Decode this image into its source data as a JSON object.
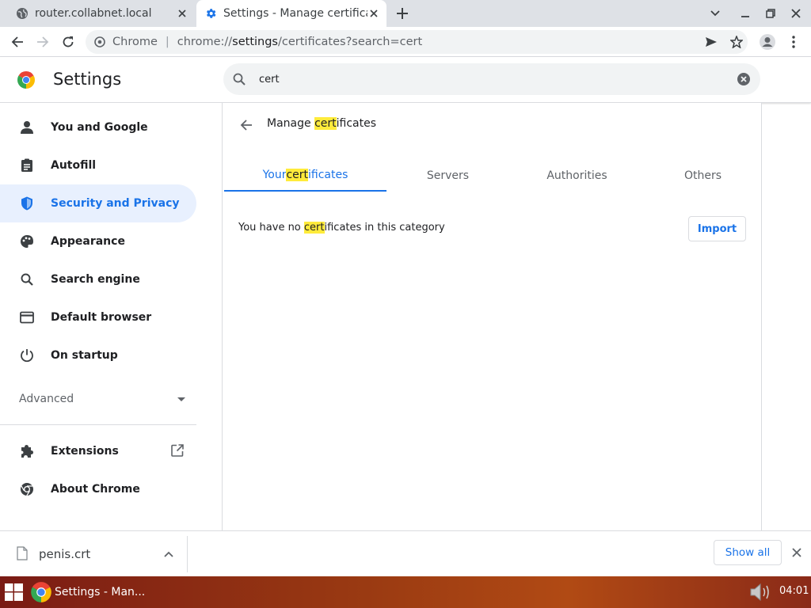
{
  "colors": {
    "accent": "#1a73e8",
    "highlight": "#ffeb3b",
    "active_nav_bg": "#e8f0fe",
    "tabstrip_bg": "#dee1e6"
  },
  "browser": {
    "tabs": [
      {
        "title": "router.collabnet.local",
        "icon": "globe-icon",
        "active": false
      },
      {
        "title": "Settings - Manage certifica",
        "icon": "gear-icon",
        "active": true
      }
    ],
    "omnibox": {
      "chip": "Chrome",
      "url_scheme": "chrome://",
      "url_host": "settings",
      "url_rest": "/certificates?search=cert"
    }
  },
  "settings": {
    "title": "Settings",
    "search_value": "cert",
    "nav": [
      {
        "label": "You and Google",
        "icon": "person-icon"
      },
      {
        "label": "Autofill",
        "icon": "clipboard-icon"
      },
      {
        "label": "Security and Privacy",
        "icon": "shield-icon",
        "active": true
      },
      {
        "label": "Appearance",
        "icon": "palette-icon"
      },
      {
        "label": "Search engine",
        "icon": "search-icon"
      },
      {
        "label": "Default browser",
        "icon": "browser-window-icon"
      },
      {
        "label": "On startup",
        "icon": "power-icon"
      }
    ],
    "advanced_label": "Advanced",
    "extensions_label": "Extensions",
    "about_label": "About Chrome"
  },
  "page": {
    "title_prefix": "Manage ",
    "title_highlight": "cert",
    "title_suffix": "ificates",
    "tabs": {
      "your_prefix": "Your ",
      "your_highlight": "cert",
      "your_suffix": "ificates",
      "servers": "Servers",
      "authorities": "Authorities",
      "others": "Others"
    },
    "empty_prefix": "You have no ",
    "empty_highlight": "cert",
    "empty_suffix": "ificates in this category",
    "import_label": "Import"
  },
  "downloads": {
    "file_name": "penis.crt",
    "show_all_label": "Show all"
  },
  "taskbar": {
    "task_label": "Settings - Man...",
    "clock": "04:01"
  }
}
